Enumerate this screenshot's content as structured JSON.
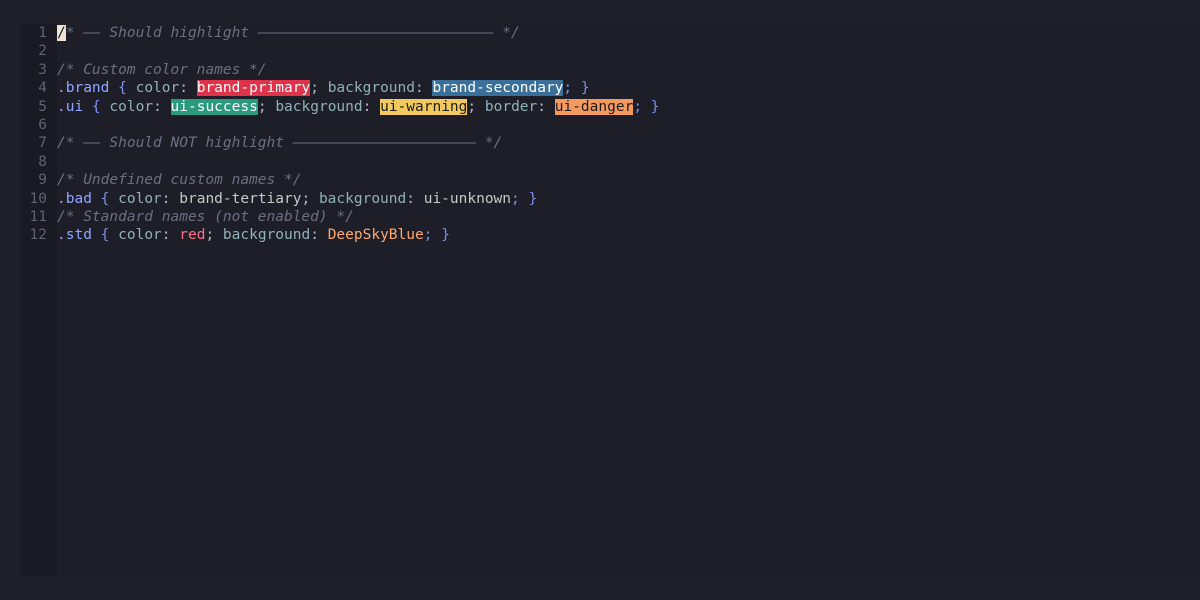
{
  "lines": [
    {
      "no": "1",
      "parts": [
        {
          "t": "/",
          "c": "cursor"
        },
        {
          "t": "* —— Should highlight ——————————————————————————— */",
          "c": "tok-comment"
        }
      ]
    },
    {
      "no": "2",
      "parts": []
    },
    {
      "no": "3",
      "parts": [
        {
          "t": "/* Custom color names */",
          "c": "tok-comment"
        }
      ]
    },
    {
      "no": "4",
      "parts": [
        {
          "t": ".brand",
          "c": "tok-sel"
        },
        {
          "t": " { ",
          "c": "tok-brace"
        },
        {
          "t": "color",
          "c": "tok-prop"
        },
        {
          "t": ": ",
          "c": "tok-punc"
        },
        {
          "t": "brand-primary",
          "c": "sw",
          "bg": "#e0334a",
          "fg": "#ffffff"
        },
        {
          "t": "; ",
          "c": "tok-punc"
        },
        {
          "t": "background",
          "c": "tok-prop"
        },
        {
          "t": ": ",
          "c": "tok-punc"
        },
        {
          "t": "brand-secondary",
          "c": "sw",
          "bg": "#3a6f9a",
          "fg": "#ffffff"
        },
        {
          "t": "; }",
          "c": "tok-brace"
        }
      ]
    },
    {
      "no": "5",
      "parts": [
        {
          "t": ".ui",
          "c": "tok-sel"
        },
        {
          "t": " { ",
          "c": "tok-brace"
        },
        {
          "t": "color",
          "c": "tok-prop"
        },
        {
          "t": ": ",
          "c": "tok-punc"
        },
        {
          "t": "ui-success",
          "c": "sw",
          "bg": "#2a9a7c",
          "fg": "#ffffff"
        },
        {
          "t": "; ",
          "c": "tok-punc"
        },
        {
          "t": "background",
          "c": "tok-prop"
        },
        {
          "t": ": ",
          "c": "tok-punc"
        },
        {
          "t": "ui-warning",
          "c": "sw",
          "bg": "#f2c95c",
          "fg": "#1c1c1c"
        },
        {
          "t": "; ",
          "c": "tok-punc"
        },
        {
          "t": "border",
          "c": "tok-prop"
        },
        {
          "t": ": ",
          "c": "tok-punc"
        },
        {
          "t": "ui-danger",
          "c": "sw",
          "bg": "#f59a5e",
          "fg": "#1c1c1c"
        },
        {
          "t": "; }",
          "c": "tok-brace"
        }
      ]
    },
    {
      "no": "6",
      "parts": []
    },
    {
      "no": "7",
      "parts": [
        {
          "t": "/* —— Should NOT highlight ————————————————————— */",
          "c": "tok-comment"
        }
      ]
    },
    {
      "no": "8",
      "parts": []
    },
    {
      "no": "9",
      "parts": [
        {
          "t": "/* Undefined custom names */",
          "c": "tok-comment"
        }
      ]
    },
    {
      "no": "10",
      "parts": [
        {
          "t": ".bad",
          "c": "tok-sel"
        },
        {
          "t": " { ",
          "c": "tok-brace"
        },
        {
          "t": "color",
          "c": "tok-prop"
        },
        {
          "t": ": ",
          "c": "tok-punc"
        },
        {
          "t": "brand-tertiary",
          "c": "tok-val"
        },
        {
          "t": "; ",
          "c": "tok-punc"
        },
        {
          "t": "background",
          "c": "tok-prop"
        },
        {
          "t": ": ",
          "c": "tok-punc"
        },
        {
          "t": "ui-unknown",
          "c": "tok-val"
        },
        {
          "t": "; }",
          "c": "tok-brace"
        }
      ]
    },
    {
      "no": "11",
      "parts": [
        {
          "t": "/* Standard names (not enabled) */",
          "c": "tok-comment"
        }
      ]
    },
    {
      "no": "12",
      "parts": [
        {
          "t": ".std",
          "c": "tok-sel"
        },
        {
          "t": " { ",
          "c": "tok-brace"
        },
        {
          "t": "color",
          "c": "tok-prop"
        },
        {
          "t": ": ",
          "c": "tok-punc"
        },
        {
          "t": "red",
          "c": "tok-red"
        },
        {
          "t": "; ",
          "c": "tok-punc"
        },
        {
          "t": "background",
          "c": "tok-prop"
        },
        {
          "t": ": ",
          "c": "tok-punc"
        },
        {
          "t": "DeepSkyBlue",
          "c": "tok-orange"
        },
        {
          "t": "; }",
          "c": "tok-brace"
        }
      ]
    }
  ]
}
